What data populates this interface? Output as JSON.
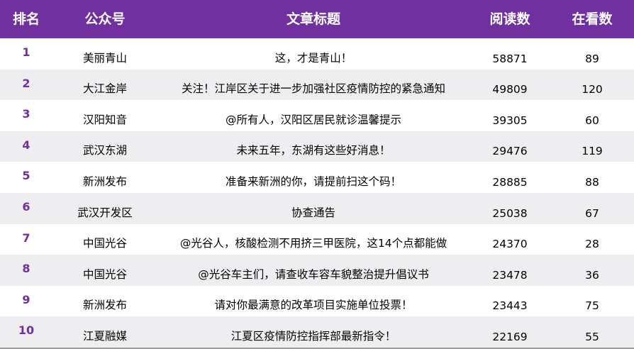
{
  "header": {
    "rank": "排名",
    "account": "公众号",
    "title": "文章标题",
    "reads": "阅读数",
    "viewing": "在看数"
  },
  "colors": {
    "header_bg": "#7030a0",
    "rank_text": "#7030a0",
    "alt_row_bg": "#eeedf0"
  },
  "rows": [
    {
      "rank": "1",
      "account": "美丽青山",
      "title": "这，才是青山！",
      "reads": "58871",
      "viewing": "89"
    },
    {
      "rank": "2",
      "account": "大江金岸",
      "title": "关注！江岸区关于进一步加强社区疫情防控的紧急通知",
      "reads": "49809",
      "viewing": "120"
    },
    {
      "rank": "3",
      "account": "汉阳知音",
      "title": "@所有人，汉阳区居民就诊温馨提示",
      "reads": "39305",
      "viewing": "60"
    },
    {
      "rank": "4",
      "account": "武汉东湖",
      "title": "未来五年，东湖有这些好消息！",
      "reads": "29476",
      "viewing": "119"
    },
    {
      "rank": "5",
      "account": "新洲发布",
      "title": "准备来新洲的你，请提前扫这个码！",
      "reads": "28885",
      "viewing": "88"
    },
    {
      "rank": "6",
      "account": "武汉开发区",
      "title": "协查通告",
      "reads": "25038",
      "viewing": "67"
    },
    {
      "rank": "7",
      "account": "中国光谷",
      "title": "@光谷人，核酸检测不用挤三甲医院，这14个点都能做",
      "reads": "24370",
      "viewing": "28"
    },
    {
      "rank": "8",
      "account": "中国光谷",
      "title": "@光谷车主们，请查收车容车貌整治提升倡议书",
      "reads": "23478",
      "viewing": "36"
    },
    {
      "rank": "9",
      "account": "新洲发布",
      "title": "请对你最满意的改革项目实施单位投票！",
      "reads": "23443",
      "viewing": "75"
    },
    {
      "rank": "10",
      "account": "江夏融媒",
      "title": "江夏区疫情防控指挥部最新指令！",
      "reads": "22169",
      "viewing": "55"
    }
  ]
}
